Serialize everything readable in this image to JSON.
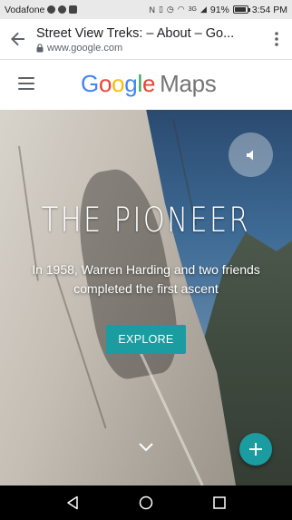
{
  "status_bar": {
    "carrier": "Vodafone",
    "signal_label": "3G",
    "battery_percent": "91%",
    "battery_level": 0.91,
    "time": "3:54 PM"
  },
  "browser": {
    "page_title": "Street View Treks: – About – Go...",
    "url": "www.google.com",
    "back_icon": "arrow-left-icon",
    "menu_icon": "more-vert-icon"
  },
  "maps_header": {
    "logo_letters": [
      {
        "ch": "G",
        "color": "#4285F4"
      },
      {
        "ch": "o",
        "color": "#EA4335"
      },
      {
        "ch": "o",
        "color": "#FBBC05"
      },
      {
        "ch": "g",
        "color": "#4285F4"
      },
      {
        "ch": "l",
        "color": "#34A853"
      },
      {
        "ch": "e",
        "color": "#EA4335"
      }
    ],
    "logo_suffix": "Maps"
  },
  "hero": {
    "title": "THE PIONEER",
    "subtitle": "In 1958, Warren Harding and two friends completed the first ascent",
    "explore_label": "EXPLORE",
    "accent_color": "#1a9ca1"
  },
  "nav_bar": {
    "back_icon": "triangle-back-icon",
    "home_icon": "circle-home-icon",
    "recents_icon": "square-recents-icon"
  }
}
